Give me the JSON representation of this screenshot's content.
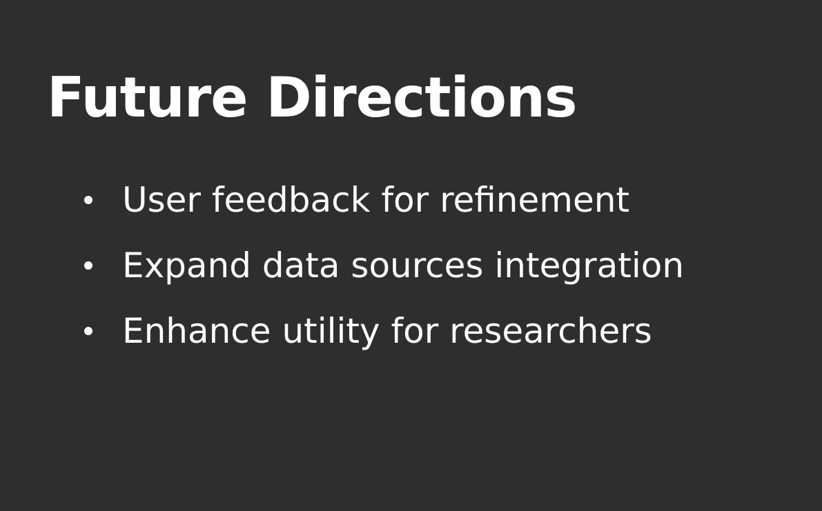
{
  "slide": {
    "title": "Future Directions",
    "bullets": [
      {
        "text": "User feedback for refinement"
      },
      {
        "text": "Expand data sources integration"
      },
      {
        "text": "Enhance utility for researchers"
      }
    ]
  },
  "theme": {
    "background": "#2e2e2e",
    "text_color": "#ffffff",
    "bullet_color": "#ffffff"
  }
}
